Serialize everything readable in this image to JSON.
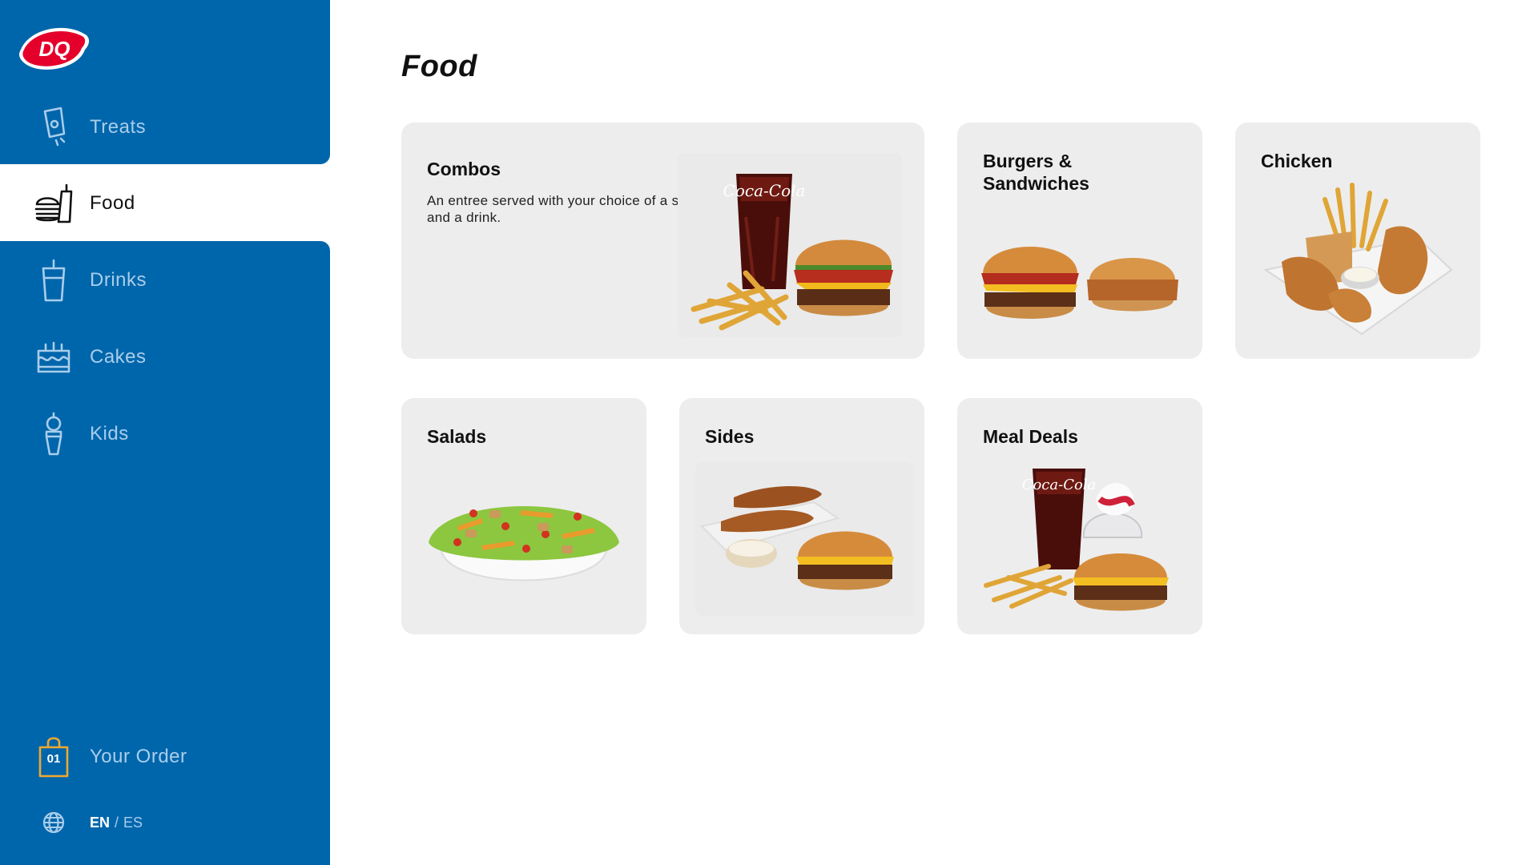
{
  "sidebar": {
    "logo_text": "DQ",
    "nav": [
      {
        "label": "Treats",
        "icon": "treat-cup-icon",
        "active": false
      },
      {
        "label": "Food",
        "icon": "burger-drink-icon",
        "active": true
      },
      {
        "label": "Drinks",
        "icon": "drink-cup-icon",
        "active": false
      },
      {
        "label": "Cakes",
        "icon": "cake-icon",
        "active": false
      },
      {
        "label": "Kids",
        "icon": "kids-cone-icon",
        "active": false
      }
    ],
    "order": {
      "label": "Your Order",
      "count": "01",
      "icon": "shopping-bag-icon"
    },
    "language": {
      "en": "EN",
      "separator": "/",
      "es": "ES",
      "icon": "globe-icon"
    }
  },
  "main": {
    "title": "Food",
    "categories": [
      {
        "title": "Combos",
        "description": "An entree served with your choice of a side and a drink."
      },
      {
        "title": "Burgers & Sandwiches"
      },
      {
        "title": "Chicken"
      },
      {
        "title": "Salads"
      },
      {
        "title": "Sides"
      },
      {
        "title": "Meal Deals"
      }
    ]
  },
  "colors": {
    "sidebar_blue": "#0066AB",
    "nav_inactive_text": "#A9CDEB",
    "card_bg": "#EDEDED",
    "order_accent": "#F0A830",
    "logo_red": "#E4002B"
  }
}
